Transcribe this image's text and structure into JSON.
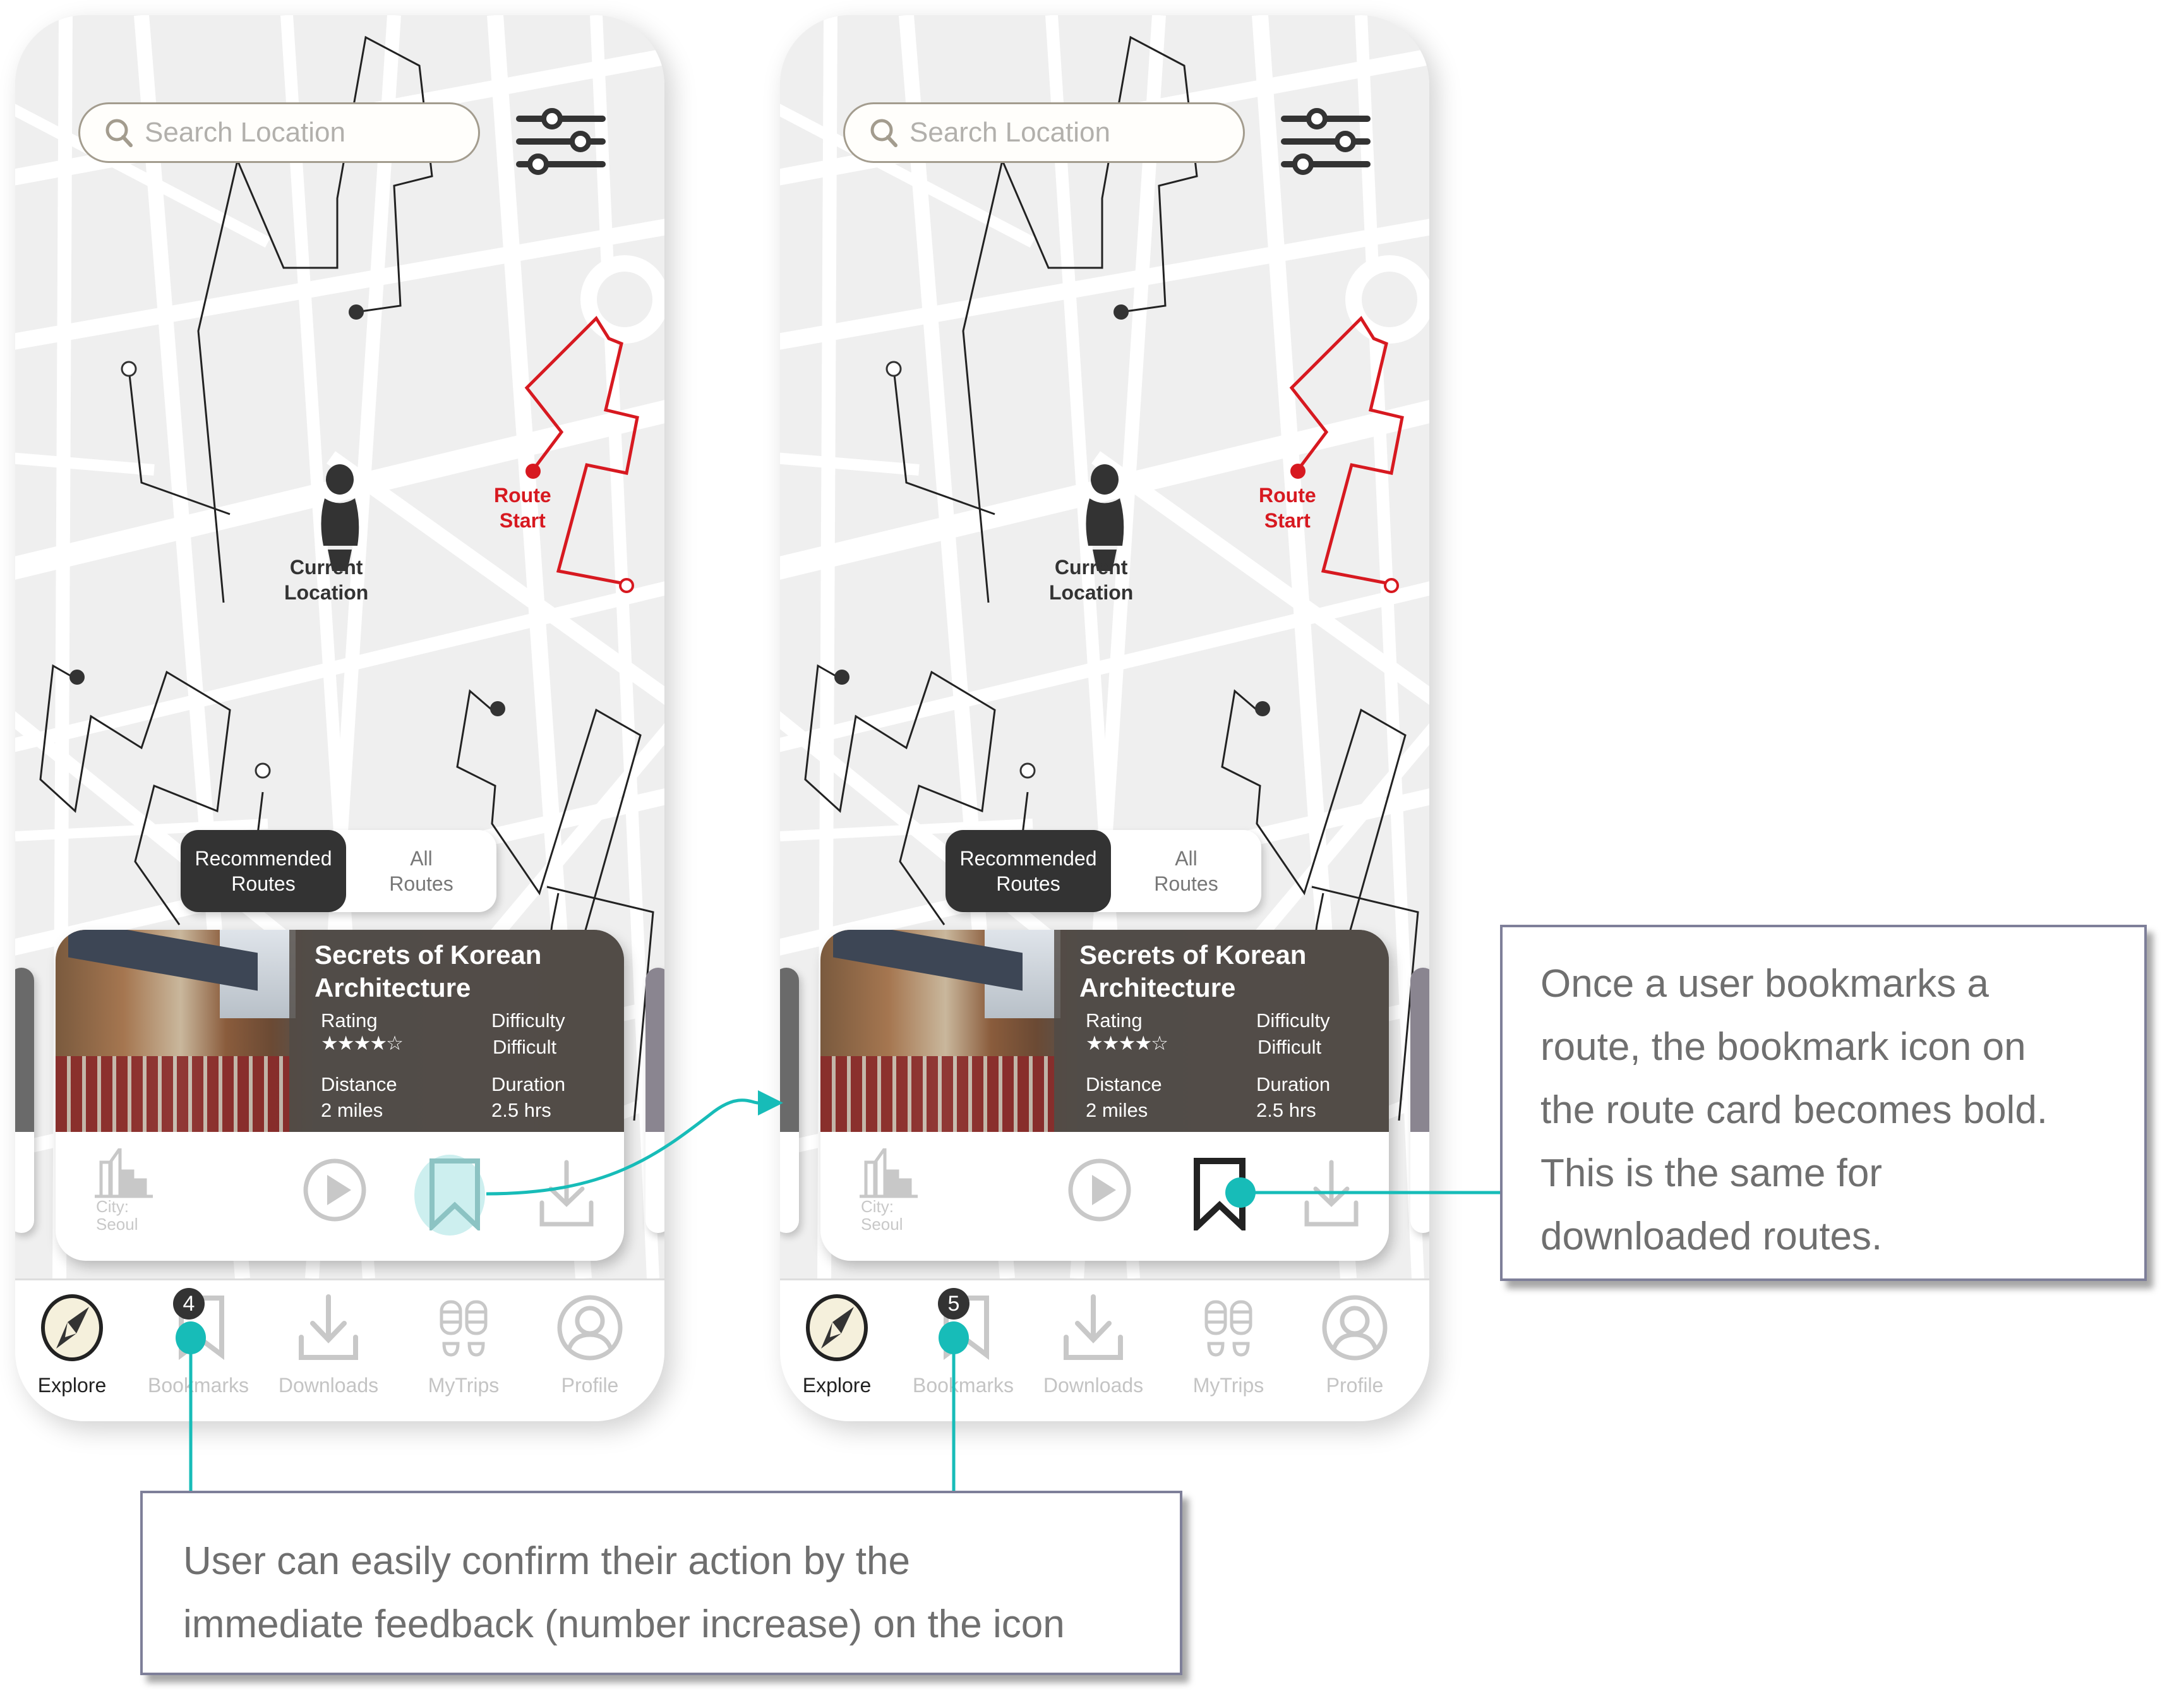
{
  "screens": [
    {
      "id": "before",
      "search": {
        "placeholder": "Search Location"
      },
      "markers": {
        "current_location": [
          "Current",
          "Location"
        ],
        "route_start": [
          "Route",
          "Start"
        ]
      },
      "route_toggle": {
        "active": [
          "Recommended",
          "Routes"
        ],
        "inactive": [
          "All",
          "Routes"
        ]
      },
      "route_card": {
        "title_lines": [
          "Secrets of Korean",
          "Architecture"
        ],
        "rating_label": "Rating",
        "rating_stars": "★★★★☆",
        "rating_value": 4,
        "rating_max": 5,
        "difficulty_label": "Difficulty",
        "difficulty_value": "Difficult",
        "distance_label": "Distance",
        "distance_value": "2 miles",
        "duration_label": "Duration",
        "duration_value": "2.5 hrs",
        "city_label": [
          "City:",
          "Seoul"
        ],
        "bookmarked": false
      },
      "nav": {
        "items": [
          "Explore",
          "Bookmarks",
          "Downloads",
          "MyTrips",
          "Profile"
        ],
        "active": "Explore",
        "bookmark_badge": "4"
      }
    },
    {
      "id": "after",
      "search": {
        "placeholder": "Search Location"
      },
      "markers": {
        "current_location": [
          "Current",
          "Location"
        ],
        "route_start": [
          "Route",
          "Start"
        ]
      },
      "route_toggle": {
        "active": [
          "Recommended",
          "Routes"
        ],
        "inactive": [
          "All",
          "Routes"
        ]
      },
      "route_card": {
        "title_lines": [
          "Secrets of Korean",
          "Architecture"
        ],
        "rating_label": "Rating",
        "rating_stars": "★★★★☆",
        "rating_value": 4,
        "rating_max": 5,
        "difficulty_label": "Difficulty",
        "difficulty_value": "Difficult",
        "distance_label": "Distance",
        "distance_value": "2 miles",
        "duration_label": "Duration",
        "duration_value": "2.5 hrs",
        "city_label": [
          "City:",
          "Seoul"
        ],
        "bookmarked": true
      },
      "nav": {
        "items": [
          "Explore",
          "Bookmarks",
          "Downloads",
          "MyTrips",
          "Profile"
        ],
        "active": "Explore",
        "bookmark_badge": "5"
      }
    }
  ],
  "annotations": {
    "right": [
      "Once a user bookmarks a",
      "route, the bookmark icon on",
      "the route card becomes bold.",
      "This is the same for",
      "downloaded routes."
    ],
    "bottom": [
      "User can easily confirm their action by the",
      "immediate feedback (number increase) on the icon"
    ]
  },
  "colors": {
    "accent_teal": "#17bcb8",
    "route_red": "#d71920",
    "dark": "#333333",
    "callout_border": "#7e7f99",
    "muted_icon": "#c6c6c6",
    "compass_fill": "#f5f0dc"
  }
}
